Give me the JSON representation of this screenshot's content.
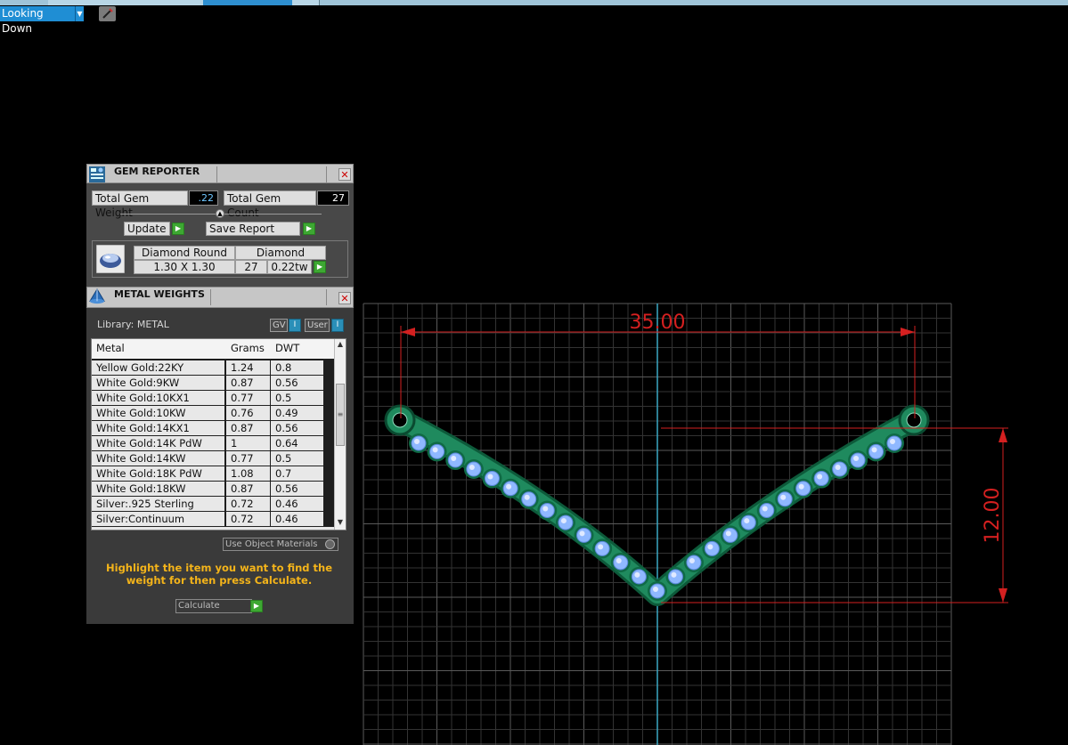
{
  "toolbar": {
    "view_select": "Looking Down",
    "tool_icon": "pencil-icon"
  },
  "gem_reporter": {
    "title": "GEM REPORTER",
    "total_weight_label": "Total Gem Weight",
    "total_weight_value": ".22",
    "total_count_label": "Total Gem Count",
    "total_count_value": "27",
    "update_label": "Update",
    "save_report_label": "Save Report",
    "gem": {
      "shape": "Diamond Round",
      "material": "Diamond",
      "size": "1.30 X 1.30",
      "count": "27",
      "weight": "0.22tw"
    }
  },
  "metal_weights": {
    "title": "METAL WEIGHTS",
    "library_label": "Library: METAL",
    "gv_label": "GV",
    "user_label": "User",
    "columns": [
      "Metal",
      "Grams",
      "DWT"
    ],
    "rows": [
      [
        "Yellow Gold:22KY",
        "1.24",
        "0.8"
      ],
      [
        "White Gold:9KW",
        "0.87",
        "0.56"
      ],
      [
        "White Gold:10KX1",
        "0.77",
        "0.5"
      ],
      [
        "White Gold:10KW",
        "0.76",
        "0.49"
      ],
      [
        "White Gold:14KX1",
        "0.87",
        "0.56"
      ],
      [
        "White Gold:14K PdW",
        "1",
        "0.64"
      ],
      [
        "White Gold:14KW",
        "0.77",
        "0.5"
      ],
      [
        "White Gold:18K PdW",
        "1.08",
        "0.7"
      ],
      [
        "White Gold:18KW",
        "0.87",
        "0.56"
      ],
      [
        "Silver:.925 Sterling",
        "0.72",
        "0.46"
      ],
      [
        "Silver:Continuum",
        "0.72",
        "0.46"
      ]
    ],
    "use_object_materials_label": "Use Object Materials",
    "hint": "Highlight the item you want to find the weight for then press Calculate.",
    "calculate_label": "Calculate"
  },
  "viewport": {
    "width_dimension": "35.00",
    "height_dimension": "12.00",
    "gem_count": 27,
    "colors": {
      "grid": "#3a3a3a",
      "dimension": "#d42020",
      "axis": "#3aa7c4",
      "metal": "#1f8a5e",
      "stone": "#8fb8ff"
    }
  }
}
